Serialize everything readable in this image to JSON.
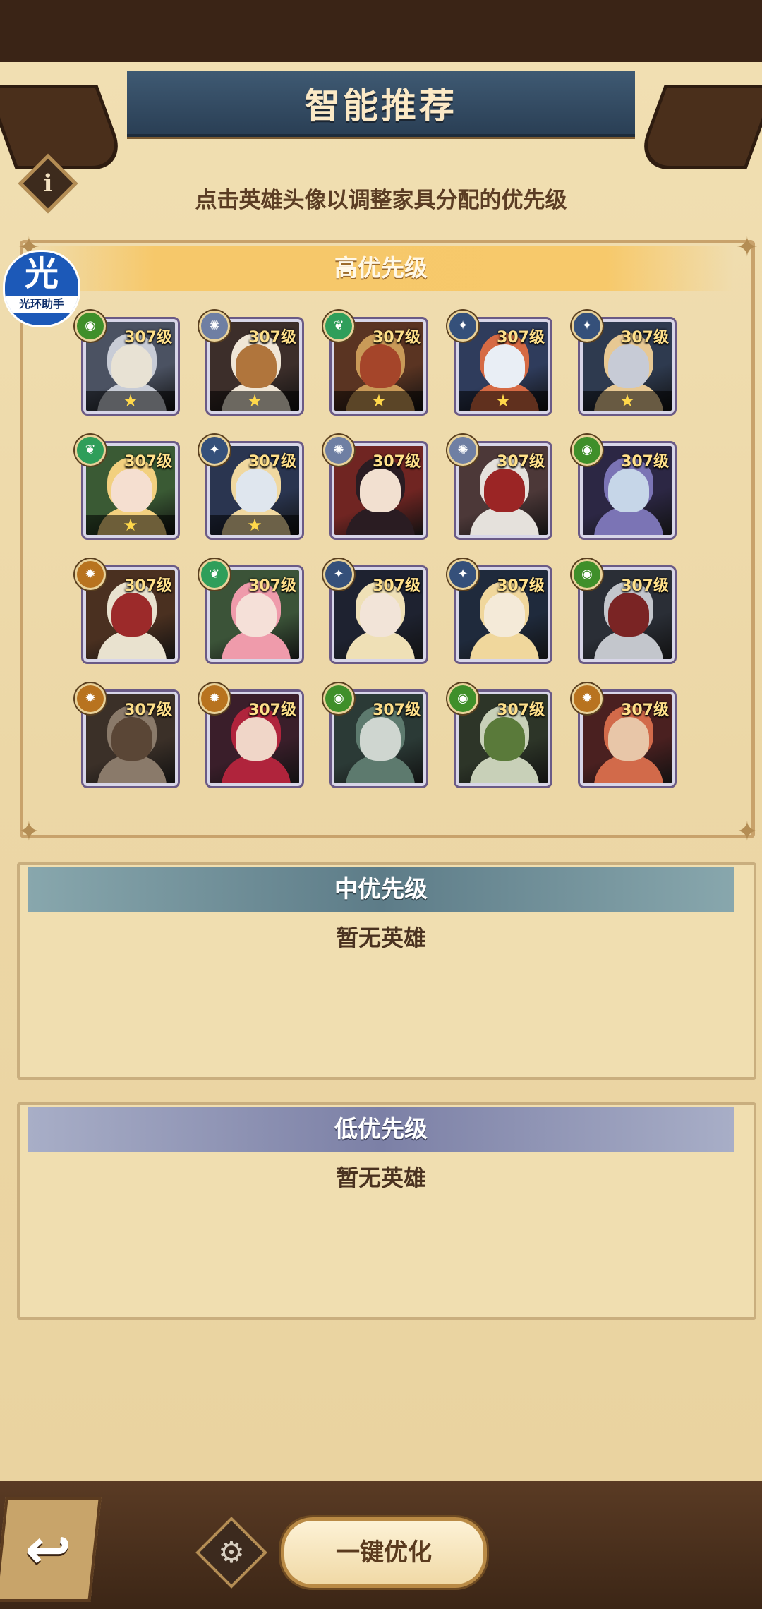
{
  "header": {
    "title": "智能推荐",
    "info_icon_glyph": "i",
    "subtitle": "点击英雄头像以调整家具分配的优先级"
  },
  "watermark": {
    "big": "光",
    "small": "光环助手"
  },
  "sections": {
    "high": {
      "label": "高优先级"
    },
    "mid": {
      "label": "中优先级",
      "empty": "暂无英雄"
    },
    "low": {
      "label": "低优先级",
      "empty": "暂无英雄"
    }
  },
  "heroes": [
    {
      "level": "307级",
      "faction": "eye-icon",
      "faction_color": "#3f8f2a",
      "star": true,
      "palette": [
        "#4b5262",
        "#c8ccd6",
        "#e8e2d4"
      ]
    },
    {
      "level": "307级",
      "faction": "sun-icon",
      "faction_color": "#6f7fa3",
      "star": true,
      "palette": [
        "#3c2e2a",
        "#f0e6d6",
        "#b0753c"
      ]
    },
    {
      "level": "307级",
      "faction": "leaf-icon",
      "faction_color": "#2f9e5a",
      "star": true,
      "palette": [
        "#5a3422",
        "#c99a58",
        "#a5452a"
      ]
    },
    {
      "level": "307级",
      "faction": "star-icon",
      "faction_color": "#35507a",
      "star": true,
      "palette": [
        "#2f3c5c",
        "#d66a44",
        "#e9eef5"
      ]
    },
    {
      "level": "307级",
      "faction": "star-icon",
      "faction_color": "#35507a",
      "star": true,
      "palette": [
        "#2e3a4f",
        "#e7c893",
        "#c7cbd6"
      ]
    },
    {
      "level": "307级",
      "faction": "leaf-icon",
      "faction_color": "#2f9e5a",
      "star": true,
      "palette": [
        "#3a5a34",
        "#f2d07f",
        "#f5dfd0"
      ]
    },
    {
      "level": "307级",
      "faction": "star-icon",
      "faction_color": "#35507a",
      "star": true,
      "palette": [
        "#2a3550",
        "#f0d8a0",
        "#dfe6ee"
      ]
    },
    {
      "level": "307级",
      "faction": "sun-icon",
      "faction_color": "#6f7fa3",
      "star": false,
      "palette": [
        "#702522",
        "#2a1c22",
        "#f2e0d0"
      ]
    },
    {
      "level": "307级",
      "faction": "sun-icon",
      "faction_color": "#6f7fa3",
      "star": false,
      "palette": [
        "#4c3838",
        "#e5e1dc",
        "#9b2525"
      ]
    },
    {
      "level": "307级",
      "faction": "eye-icon",
      "faction_color": "#3f8f2a",
      "star": false,
      "palette": [
        "#2c2744",
        "#7b74b5",
        "#c6d6e8"
      ]
    },
    {
      "level": "307级",
      "faction": "flame-icon",
      "faction_color": "#b8731f",
      "star": false,
      "palette": [
        "#4a3020",
        "#e9e2cf",
        "#9c2a2a"
      ]
    },
    {
      "level": "307级",
      "faction": "leaf-icon",
      "faction_color": "#2f9e5a",
      "star": false,
      "palette": [
        "#3b5338",
        "#ef9bab",
        "#f5e0d8"
      ]
    },
    {
      "level": "307级",
      "faction": "star-icon",
      "faction_color": "#35507a",
      "star": false,
      "palette": [
        "#1e2230",
        "#efe0b6",
        "#f2e4d8"
      ]
    },
    {
      "level": "307级",
      "faction": "star-icon",
      "faction_color": "#35507a",
      "star": false,
      "palette": [
        "#1f2a3c",
        "#f0d79c",
        "#f4ead8"
      ]
    },
    {
      "level": "307级",
      "faction": "eye-icon",
      "faction_color": "#3f8f2a",
      "star": false,
      "palette": [
        "#2a2e36",
        "#c3c6cc",
        "#7a2424"
      ]
    },
    {
      "level": "307级",
      "faction": "flame-icon",
      "faction_color": "#b8731f",
      "star": false,
      "palette": [
        "#3b3028",
        "#8a7a6a",
        "#5a4636"
      ]
    },
    {
      "level": "307级",
      "faction": "flame-icon",
      "faction_color": "#b8731f",
      "star": false,
      "palette": [
        "#3a1e2a",
        "#b0243c",
        "#f0d6c8"
      ]
    },
    {
      "level": "307级",
      "faction": "eye-icon",
      "faction_color": "#3f8f2a",
      "star": false,
      "palette": [
        "#2b3a36",
        "#5d7a6e",
        "#cfd6d0"
      ]
    },
    {
      "level": "307级",
      "faction": "eye-icon",
      "faction_color": "#3f8f2a",
      "star": false,
      "palette": [
        "#2d3528",
        "#c8d0b8",
        "#5a7a3a"
      ]
    },
    {
      "level": "307级",
      "faction": "flame-icon",
      "faction_color": "#b8731f",
      "star": false,
      "palette": [
        "#4a2020",
        "#d26a4a",
        "#e8c6a8"
      ]
    }
  ],
  "star_glyph": "★",
  "footer": {
    "back_glyph": "↩",
    "gear_glyph": "⚙",
    "optimize_label": "一键优化"
  }
}
